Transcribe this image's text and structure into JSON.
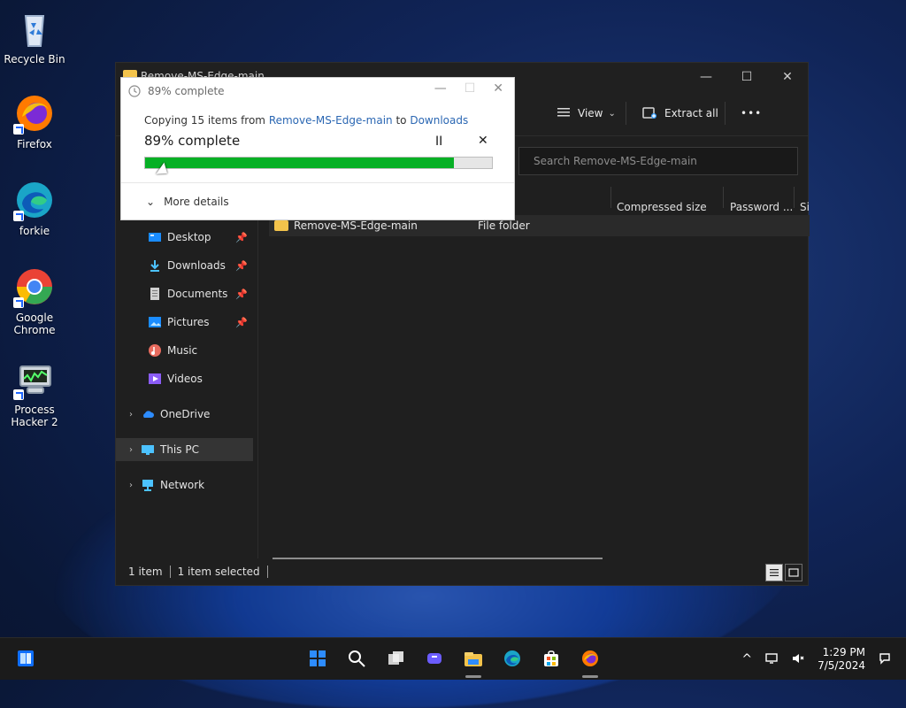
{
  "desktop": {
    "icons": [
      {
        "name": "Recycle Bin"
      },
      {
        "name": "Firefox"
      },
      {
        "name": "forkie"
      },
      {
        "name": "Google Chrome"
      },
      {
        "name": "Process Hacker 2"
      }
    ]
  },
  "explorer": {
    "title": "Remove-MS-Edge-main",
    "toolbar": {
      "view_label": "View",
      "extract_all_label": "Extract all",
      "more_label": "•••"
    },
    "search_placeholder": "Search Remove-MS-Edge-main",
    "columns": {
      "compressed_size": "Compressed size",
      "password": "Password ...",
      "size_partial": "Si"
    },
    "nav": {
      "desktop": "Desktop",
      "downloads": "Downloads",
      "documents": "Documents",
      "pictures": "Pictures",
      "music": "Music",
      "videos": "Videos",
      "onedrive": "OneDrive",
      "this_pc": "This PC",
      "network": "Network"
    },
    "files": [
      {
        "name": "Remove-MS-Edge-main",
        "type": "File folder"
      }
    ],
    "status": {
      "items": "1 item",
      "selected": "1 item selected"
    }
  },
  "progress_dialog": {
    "title": "89% complete",
    "copy_prefix": "Copying 15 items from ",
    "from": "Remove-MS-Edge-main",
    "to_word": " to ",
    "to": "Downloads",
    "percent_text": "89% complete",
    "progress": 0.89,
    "more_details": "More details",
    "pause_symbol": "II",
    "close_symbol": "✕"
  },
  "taskbar": {
    "time": "1:29 PM",
    "date": "7/5/2024"
  },
  "colors": {
    "progress_green": "#06b025",
    "link_blue": "#2b67b3"
  }
}
